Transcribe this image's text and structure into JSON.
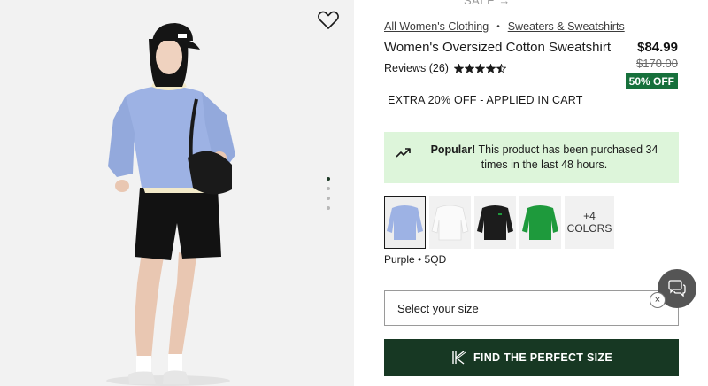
{
  "gallery": {
    "wishlist_icon": "heart-outline-icon",
    "dots_total": 4,
    "active_dot": 1
  },
  "header": {
    "sale_label": "SALE →"
  },
  "breadcrumb": {
    "items": [
      {
        "label": "All Women's Clothing"
      },
      {
        "label": "Sweaters & Sweatshirts"
      }
    ],
    "separator": "•"
  },
  "product": {
    "title": "Women's Oversized Cotton Sweatshirt",
    "price": "$84.99",
    "original_price": "$170.00",
    "discount": "50% OFF",
    "reviews_label": "Reviews (26)",
    "rating": 4.5,
    "rating_max": 5
  },
  "promo": {
    "text": "EXTRA 20% OFF - APPLIED IN CART"
  },
  "popular": {
    "bold": "Popular!",
    "text": " This product has been purchased 34 times in the last 48 hours.",
    "icon": "trending-up-icon"
  },
  "colors": {
    "swatches": [
      {
        "name": "purple",
        "color": "#9db2e4"
      },
      {
        "name": "white",
        "color": "#f4f4f4"
      },
      {
        "name": "black",
        "color": "#1c1c1c"
      },
      {
        "name": "green",
        "color": "#1e9a3c"
      }
    ],
    "more_label_line1": "+4",
    "more_label_line2": "COLORS",
    "selected_caption": "Purple • 5QD"
  },
  "size": {
    "placeholder": "Select your size"
  },
  "perfect_size": {
    "label": "FIND THE PERFECT SIZE",
    "icon": "k-logo-icon"
  },
  "chat": {
    "icon": "chat-icon",
    "close": "×"
  },
  "theme": {
    "brand_green": "#173823",
    "badge_green": "#16703b",
    "popular_bg": "#ddf5da"
  }
}
